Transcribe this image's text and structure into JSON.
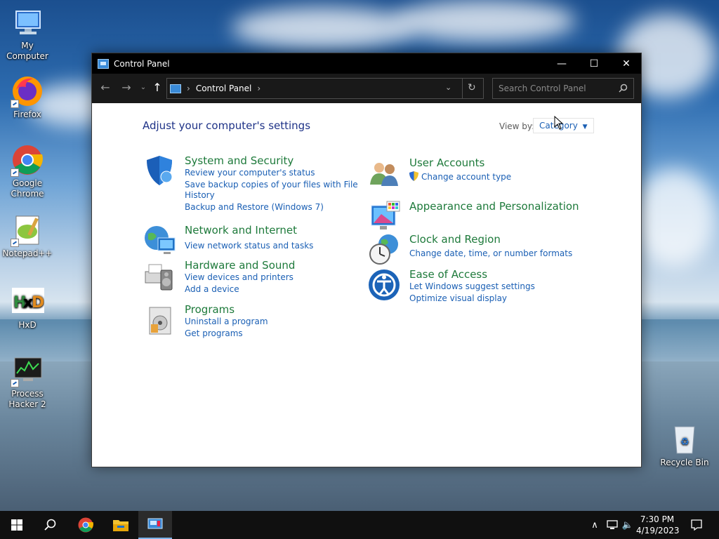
{
  "desktop": {
    "icons": [
      {
        "label": "My Computer"
      },
      {
        "label": "Firefox"
      },
      {
        "label": "Google Chrome"
      },
      {
        "label": "Notepad++"
      },
      {
        "label": "HxD"
      },
      {
        "label": "Process Hacker 2"
      },
      {
        "label": "Recycle Bin"
      }
    ]
  },
  "window": {
    "title": "Control Panel",
    "controls": {
      "minimize": "—",
      "maximize": "☐",
      "close": "✕"
    },
    "address": {
      "crumb": "Control Panel",
      "separator": "›"
    },
    "search": {
      "placeholder": "Search Control Panel"
    },
    "heading": "Adjust your computer's settings",
    "view_by": {
      "label": "View by:",
      "value": "Category"
    },
    "categories": [
      {
        "title": "System and Security",
        "links": [
          "Review your computer's status",
          "Save backup copies of your files with File",
          "History",
          "Backup and Restore (Windows 7)"
        ]
      },
      {
        "title": "Network and Internet",
        "links": [
          "View network status and tasks"
        ]
      },
      {
        "title": "Hardware and Sound",
        "links": [
          "View devices and printers",
          "Add a device"
        ]
      },
      {
        "title": "Programs",
        "links": [
          "Uninstall a program",
          "Get programs"
        ]
      },
      {
        "title": "User Accounts",
        "links": [
          "Change account type"
        ]
      },
      {
        "title": "Appearance and Personalization",
        "links": []
      },
      {
        "title": "Clock and Region",
        "links": [
          "Change date, time, or number formats"
        ]
      },
      {
        "title": "Ease of Access",
        "links": [
          "Let Windows suggest settings",
          "Optimize visual display"
        ]
      }
    ]
  },
  "taskbar": {
    "clock": {
      "time": "7:30 PM",
      "date": "4/19/2023"
    },
    "tray": {
      "chevron": "∧",
      "volume": "🔈"
    }
  },
  "colors": {
    "accent": "#1a5fb4",
    "category_title": "#1e7a3b",
    "heading": "#1e3287",
    "taskbar": "#101010"
  }
}
